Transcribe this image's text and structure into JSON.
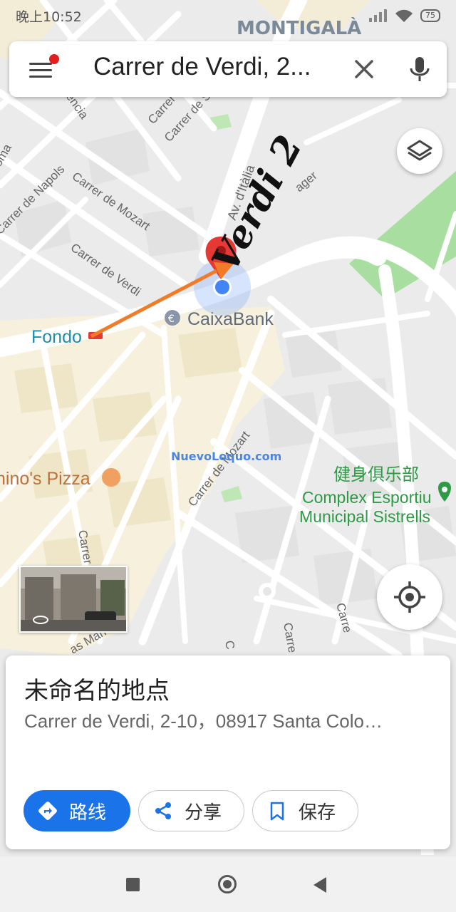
{
  "status_bar": {
    "time": "晚上10:52",
    "battery": "75"
  },
  "search": {
    "query": "Carrer de Verdi, 2..."
  },
  "map": {
    "top_label": "MONTIGALÀ",
    "streets": [
      "Carrer de Napols",
      "Carrer de Mozart",
      "Carrer de Verdi",
      "Av. d'Itàlia",
      "Carrer de Mozart",
      "Carrer de",
      "Carrer de S",
      "encia",
      "oma",
      "ager"
    ],
    "pois": {
      "caixabank": "CaixaBank",
      "fondo": "Fondo",
      "pizza": "nino's Pizza",
      "gym_cn": "健身俱乐部",
      "gym_line1": "Complex Esportiu",
      "gym_line2": "Municipal Sistrells"
    },
    "annotation": "Verdi 2",
    "watermark": "NuevoLoquo.com",
    "fragments": [
      "Carrer",
      "Carre",
      "Carre",
      "as Man",
      "C"
    ]
  },
  "place_card": {
    "title": "未命名的地点",
    "address": "Carrer de Verdi, 2-10，08917 Santa Colo…"
  },
  "actions": {
    "directions": "路线",
    "share": "分享",
    "save": "保存"
  },
  "colors": {
    "accent_blue": "#1a73e8",
    "pin_red": "#e53935",
    "arrow_orange": "#f07c28",
    "park_green": "#a8dfa0",
    "poi_green": "#2e9a46"
  },
  "icons": [
    "menu-icon",
    "clear-icon",
    "mic-icon",
    "layers-icon",
    "my-location-icon",
    "directions-icon",
    "share-icon",
    "bookmark-icon",
    "location-pin-icon",
    "euro-icon",
    "restaurant-icon",
    "rail-icon",
    "street-view-icon"
  ]
}
